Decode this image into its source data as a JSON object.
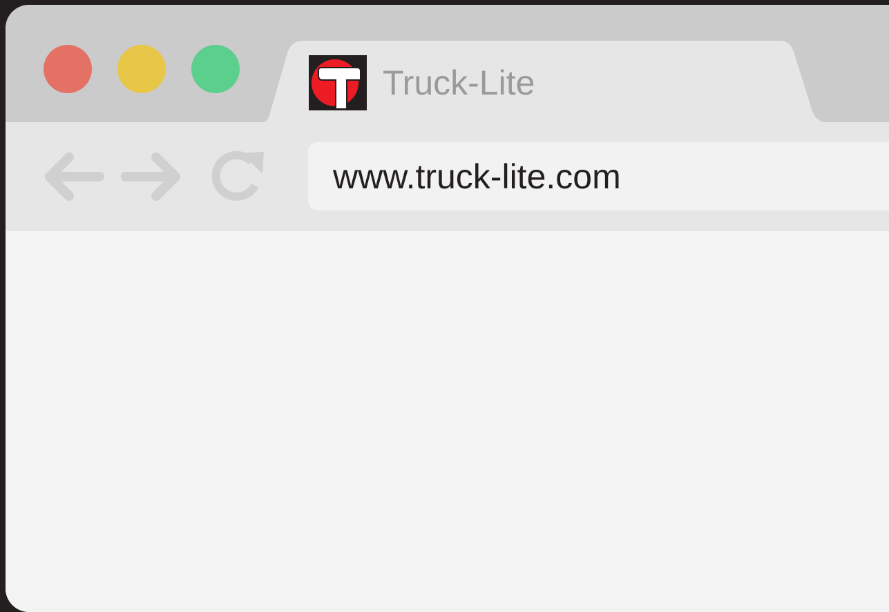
{
  "window": {
    "traffic_lights": [
      {
        "name": "close",
        "color": "#e37265"
      },
      {
        "name": "minimize",
        "color": "#e8c647"
      },
      {
        "name": "maximize",
        "color": "#5ccf8d"
      }
    ]
  },
  "tab": {
    "title": "Truck-Lite",
    "favicon": "truck-lite-logo-icon",
    "favicon_colors": {
      "background": "#231f20",
      "circle": "#ed1c24",
      "letter": "#ffffff"
    }
  },
  "toolbar": {
    "back_icon": "arrow-left-icon",
    "forward_icon": "arrow-right-icon",
    "reload_icon": "reload-icon",
    "icon_color": "#d0d0d0"
  },
  "address_bar": {
    "url": "www.truck-lite.com"
  }
}
